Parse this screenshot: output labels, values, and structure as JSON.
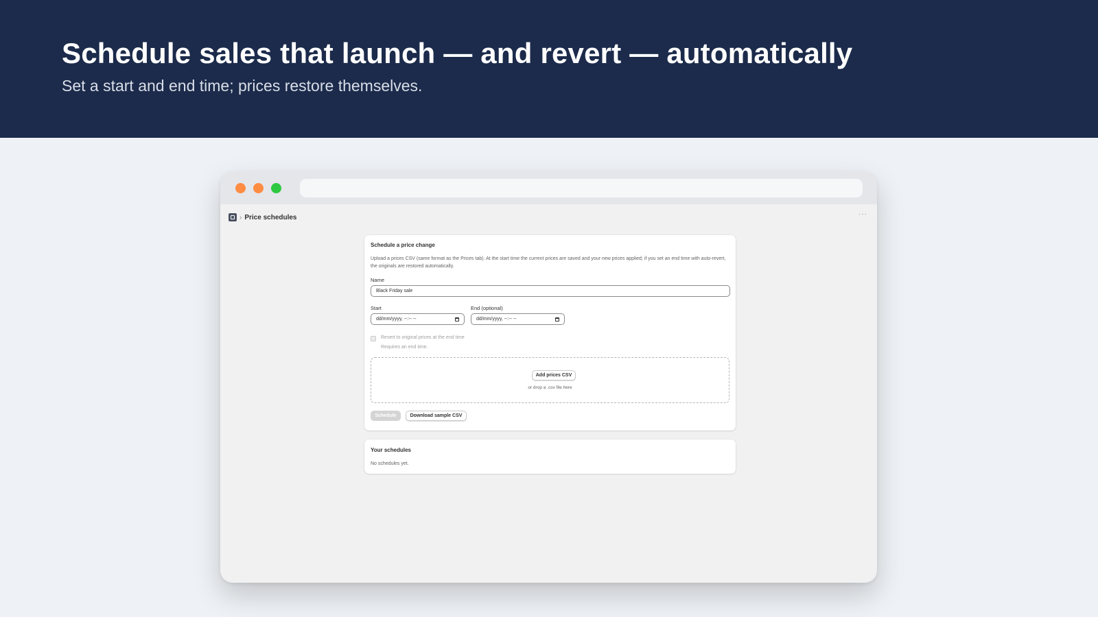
{
  "hero": {
    "title": "Schedule sales that launch — and revert — automatically",
    "subtitle": "Set a start and end time; prices restore themselves."
  },
  "browser": {
    "traffic_lights": [
      "#ff8c42",
      "#ff8c42",
      "#2ec840"
    ],
    "url": ""
  },
  "header": {
    "breadcrumb_icon": "store-icon",
    "separator": "›",
    "title": "Price schedules",
    "more_label": "···"
  },
  "schedule_card": {
    "title": "Schedule a price change",
    "description": "Upload a prices CSV (same format as the Prices tab). At the start time the current prices are saved and your new prices applied; if you set an end time with auto-revert, the originals are restored automatically.",
    "name_label": "Name",
    "name_value": "Black Friday sale",
    "start_label": "Start",
    "start_placeholder": "dd/mm/yyyy, --:-- --",
    "end_label": "End (optional)",
    "end_placeholder": "dd/mm/yyyy, --:-- --",
    "revert_label": "Revert to original prices at the end time",
    "revert_help": "Requires an end time.",
    "revert_checked": false,
    "add_csv_label": "Add prices CSV",
    "drop_hint": "or drop a .csv file here",
    "schedule_button": "Schedule",
    "sample_button": "Download sample CSV"
  },
  "schedules_card": {
    "title": "Your schedules",
    "empty_text": "No schedules yet."
  }
}
